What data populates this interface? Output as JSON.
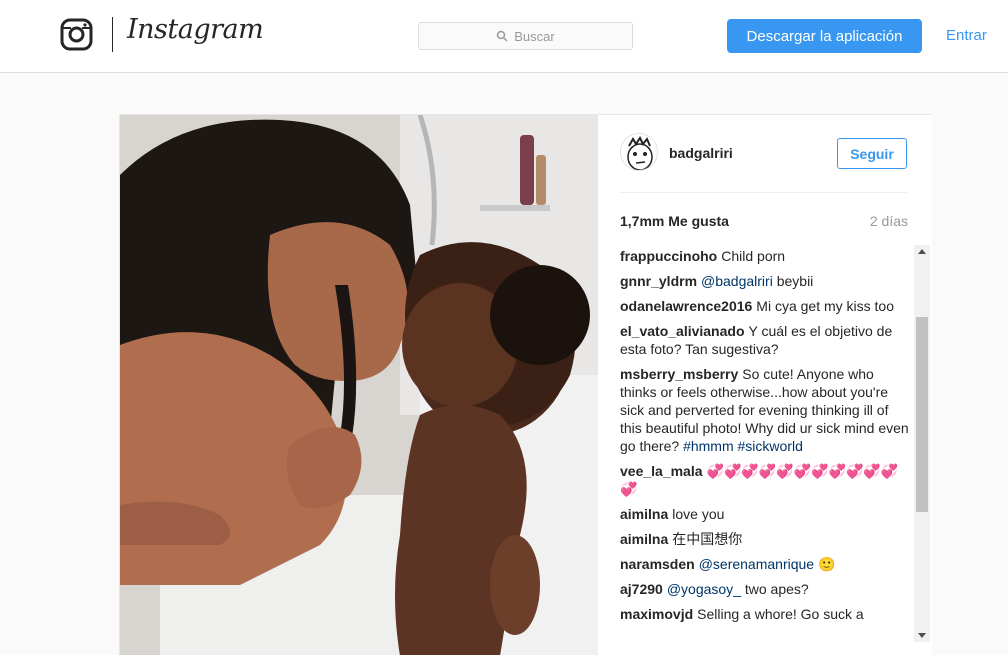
{
  "header": {
    "brand": "Instagram",
    "search_placeholder": "Buscar",
    "download_label": "Descargar la aplicación",
    "login_label": "Entrar"
  },
  "post": {
    "username": "badgalriri",
    "follow_label": "Seguir",
    "likes": "1,7mm Me gusta",
    "time": "2 días",
    "comments": [
      {
        "author": "frappuccinoho",
        "text": "Child porn"
      },
      {
        "author": "gnnr_yldrm",
        "mention": "@badgalriri",
        "text": " beybii"
      },
      {
        "author": "odanelawrence2016",
        "text": "Mi cya get my kiss too"
      },
      {
        "author": "el_vato_alivianado",
        "text": "Y cuál es el objetivo de esta foto? Tan sugestiva?"
      },
      {
        "author": "msberry_msberry",
        "text": "So cute! Anyone who thinks or feels otherwise...how about you're sick and perverted for evening thinking ill of this beautiful photo! Why did ur sick mind even go there? ",
        "mention": "#hmmm #sickworld",
        "mention_after": true
      },
      {
        "author": "vee_la_mala",
        "text": "💞💞💞💞💞💞💞💞💞💞💞💞"
      },
      {
        "author": "aimilna",
        "text": "love you"
      },
      {
        "author": "aimilna",
        "text": "在中国想你"
      },
      {
        "author": "naramsden",
        "mention": "@serenamanrique",
        "text": " 🙂"
      },
      {
        "author": "aj7290",
        "mention": "@yogasoy_",
        "text": " two apes?"
      },
      {
        "author": "maximovjd",
        "text": "Selling a whore! Go suck a"
      }
    ]
  },
  "colors": {
    "accent": "#3897f0",
    "mention": "#003569",
    "border": "#dbdbdb"
  },
  "icons": {
    "logo": "instagram-camera-icon",
    "search": "search-icon",
    "scroll_up": "arrow-up-icon",
    "scroll_down": "arrow-down-icon"
  }
}
